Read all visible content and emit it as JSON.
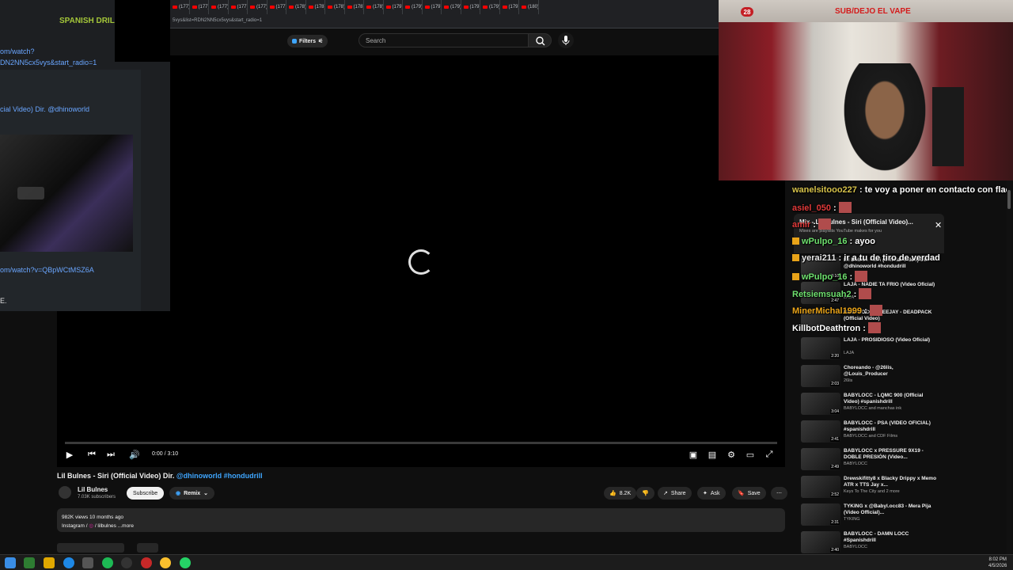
{
  "browser": {
    "tabs": [
      "(177) V",
      "(177) V",
      "(177) A",
      "(177) V",
      "(177) V",
      "(177) V",
      "(178) L",
      "(178) H",
      "(178) B",
      "(178) Z",
      "(178) B",
      "(179) F",
      "(179) O",
      "(179) T",
      "(179) B",
      "(179) K",
      "(179) B",
      "(179) D",
      "(180)"
    ],
    "url": "5vys&list=RDN2NN5cx5vys&start_radio=1"
  },
  "yt_header": {
    "filters_label": "Filters",
    "search_placeholder": "Search"
  },
  "left_panel": {
    "label_top": "SPANISH DRIL",
    "link1_line1": "om/watch?",
    "link1_line2": "DN2NN5cx5vys&start_radio=1",
    "title_link": "cial Video) Dir. @dhinoworld",
    "link2": "om/watch?v=QBpWCtMSZ6A",
    "trail": "E."
  },
  "player": {
    "time": "0:00 / 3:10",
    "progress": 0
  },
  "video_info": {
    "title": "Lil Bulnes - Siri (Official Video) Dir. ",
    "title_tags": "@dhinoworld #hondudrill",
    "channel": "Lil Bulnes",
    "subscribers": "7.03K subscribers",
    "subscribe_label": "Subscribe",
    "remix_label": "Remix",
    "likes": "8.2K",
    "share_label": "Share",
    "ask_label": "Ask",
    "save_label": "Save",
    "desc_line1": "982K views  10 months ago",
    "desc_line2": "Instagram /",
    "desc_handle": "/ lilbulnes",
    "desc_more": "...more"
  },
  "webcam": {
    "live_count": "28",
    "title": "SUB/DEJO EL VAPE"
  },
  "mix_panel": {
    "title": "Mix - Lil Bulnes - Siri (Official Video)...",
    "subtitle": "Mixes are playlists YouTube makes for you",
    "items": [
      {
        "title": "Lil Bulnes - Siri (Official Video) Dir. @dhinoworld #hondudrill",
        "channel": "",
        "duration": "3:10"
      },
      {
        "title": "LAJA - NADIE TA FRIO (Video Oficial)",
        "channel": "LAJA",
        "duration": "2:47"
      },
      {
        "title": "BABYLOCC x CEEJAY - DEADPACK (Official Video)",
        "channel": "",
        "duration": "2:41"
      },
      {
        "title": "LAJA - PROSIDIOSO (Video Oficial)",
        "channel": "LAJA",
        "duration": "2:20"
      },
      {
        "title": "Choreando - @26lis, @Louis_Producer",
        "channel": "26lis",
        "duration": "2:03"
      },
      {
        "title": "BABYLOCC - LQMC 900 (Official Video) #spanishdrill",
        "channel": "BABYLOCC and manchas ink",
        "duration": "3:04"
      },
      {
        "title": "BABYLOCC - PSA (VIDEO OFICIAL) #spanishdrill",
        "channel": "BABYLOCC and CDF Films",
        "duration": "2:41"
      },
      {
        "title": "BABYLOCC x PRESSURE 9X19 - DOBLE PRESIÓN (Video...",
        "channel": "BABYLOCC",
        "duration": "2:49"
      },
      {
        "title": "Drewskifitty8 x Blacky Drippy x Memo ATR x TTS Jay x...",
        "channel": "Keys To The City and 2 more",
        "duration": "2:52"
      },
      {
        "title": "TYKING x @Babyl.occ83 - Mera Pija (Video Official)...",
        "channel": "TYKING",
        "duration": "2:31"
      },
      {
        "title": "BABYLOCC - DAMN LOCC #Spanishdrill",
        "channel": "BABYLOCC",
        "duration": "2:40"
      }
    ]
  },
  "chat": [
    {
      "user": "wanelsitooo227",
      "user_color": "#d6c24a",
      "msg": "te voy a poner en contacto con flac",
      "badge": false
    },
    {
      "user": "asiel_050",
      "user_color": "#e23a3a",
      "msg": "",
      "badge": false
    },
    {
      "user": "amir",
      "user_color": "#e23a3a",
      "msg": "",
      "badge": false
    },
    {
      "user": "wPulpo_16",
      "user_color": "#6ee06e",
      "msg": "ayoo",
      "badge": true
    },
    {
      "user": "yerai211",
      "user_color": "#e8e8e8",
      "msg": "ir a tu de tiro de verdad",
      "badge": true
    },
    {
      "user": "wPulpo_16",
      "user_color": "#6ee06e",
      "msg": "",
      "badge": true
    },
    {
      "user": "Retsiemsuah2",
      "user_color": "#6ee06e",
      "msg": "",
      "badge": false
    },
    {
      "user": "MinerMichal1999",
      "user_color": "#e8a319",
      "msg": "",
      "badge": false
    },
    {
      "user": "KillbotDeathtron",
      "user_color": "#ffffff",
      "msg": "",
      "badge": false
    }
  ],
  "clock": {
    "time": "8:02 PM",
    "date": "4/5/2026"
  },
  "colors": {
    "yt_red": "#ff0000",
    "link_blue": "#3ea6ff",
    "cam_title_red": "#d41b1b",
    "live_red": "#c41e24"
  }
}
